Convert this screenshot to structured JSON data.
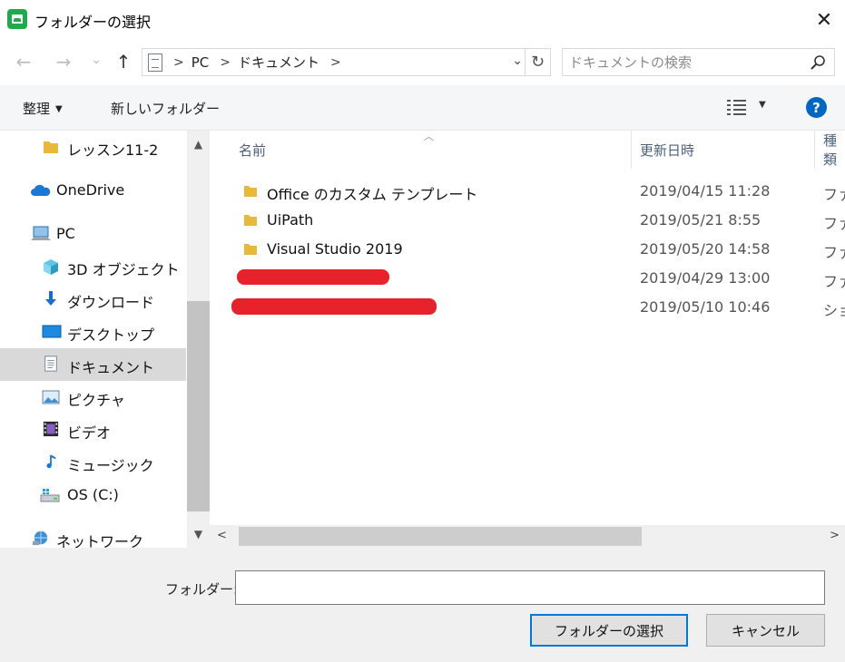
{
  "window": {
    "title": "フォルダーの選択",
    "close_glyph": "✕",
    "accent": "#1fab4b"
  },
  "nav": {
    "back_glyph": "←",
    "forward_glyph": "→",
    "history_glyph": "⌄",
    "up_glyph": "↑",
    "breadcrumb": [
      "PC",
      "ドキュメント"
    ],
    "search_placeholder": "ドキュメントの検索"
  },
  "commands": {
    "organize": "整理",
    "new_folder": "新しいフォルダー",
    "help": "?"
  },
  "sidebar": {
    "items": [
      {
        "label": "レッスン11-2",
        "icon": "folder-icon"
      },
      {
        "label": "OneDrive",
        "icon": "cloud-icon"
      },
      {
        "label": "PC",
        "icon": "computer-icon"
      },
      {
        "label": "3D オブジェクト",
        "icon": "cube-icon"
      },
      {
        "label": "ダウンロード",
        "icon": "download-icon"
      },
      {
        "label": "デスクトップ",
        "icon": "desktop-icon"
      },
      {
        "label": "ドキュメント",
        "icon": "document-icon",
        "selected": true
      },
      {
        "label": "ピクチャ",
        "icon": "picture-icon"
      },
      {
        "label": "ビデオ",
        "icon": "video-icon"
      },
      {
        "label": "ミュージック",
        "icon": "music-icon"
      },
      {
        "label": "OS (C:)",
        "icon": "drive-icon"
      },
      {
        "label": "ネットワーク",
        "icon": "network-icon"
      }
    ]
  },
  "file_list": {
    "columns": [
      "名前",
      "更新日時",
      "種類"
    ],
    "rows": [
      {
        "name": "Office のカスタム テンプレート",
        "date": "2019/04/15 11:28",
        "type": "ファ"
      },
      {
        "name": "UiPath",
        "date": "2019/05/21 8:55",
        "type": "ファ"
      },
      {
        "name": "Visual Studio 2019",
        "date": "2019/05/20 14:58",
        "type": "ファ"
      },
      {
        "name": "",
        "date": "2019/04/29 13:00",
        "type": "ファ",
        "redacted": true
      },
      {
        "name": "",
        "date": "2019/05/10 10:46",
        "type": "ショ",
        "redacted": true
      }
    ]
  },
  "footer": {
    "folder_label": "フォルダー:",
    "folder_value": "",
    "select_button": "フォルダーの選択",
    "cancel_button": "キャンセル"
  },
  "colors": {
    "selected_bg": "#d9d9d9",
    "redaction": "#e8222a",
    "primary_border": "#0078d7",
    "help_blue": "#0067c0"
  }
}
